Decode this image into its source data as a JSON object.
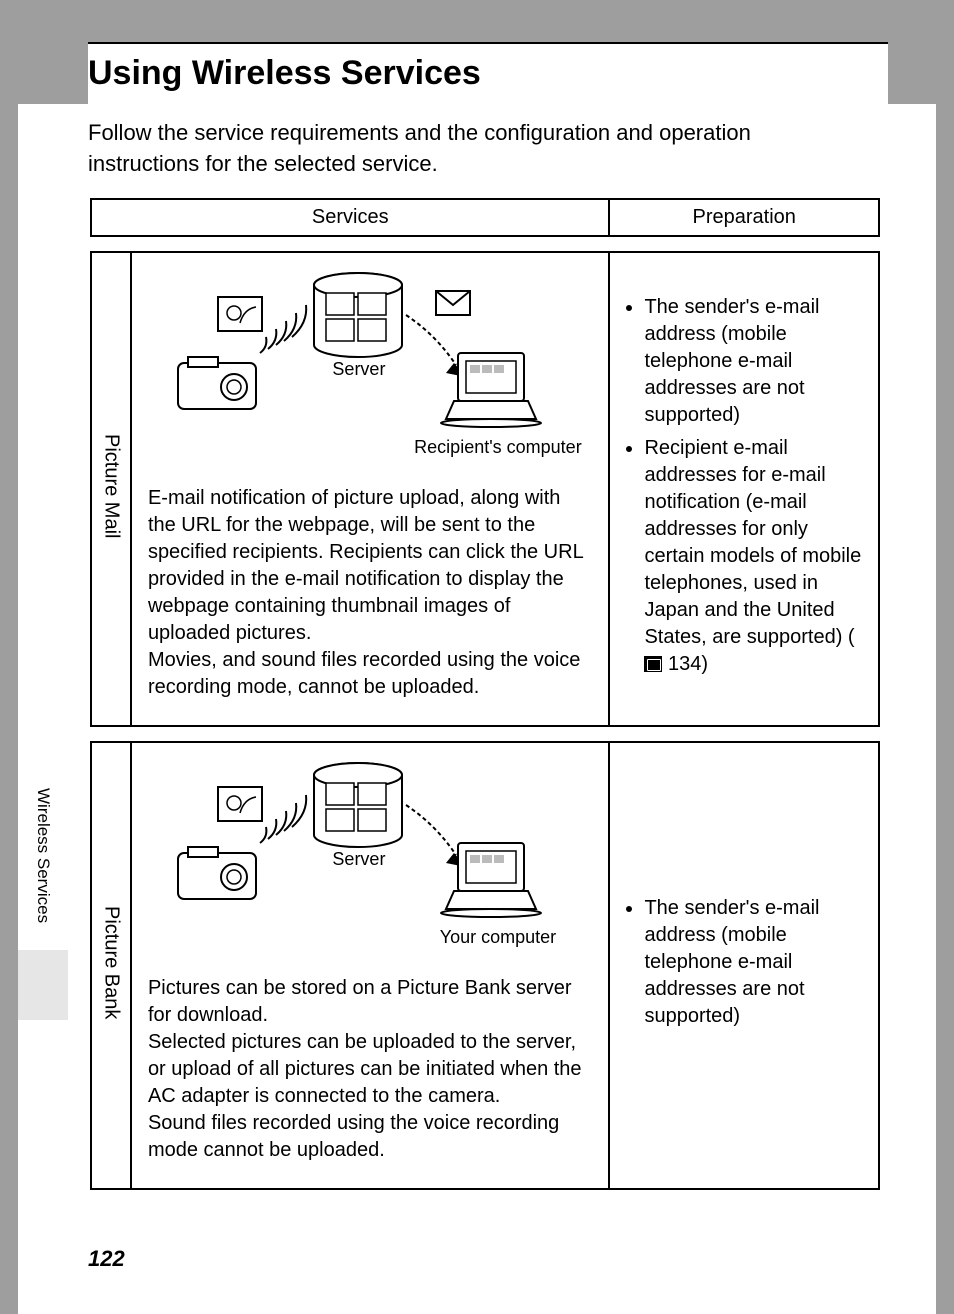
{
  "title": "Using Wireless Services",
  "intro": "Follow the service requirements and the configuration and operation instructions for the selected service.",
  "headers": {
    "services": "Services",
    "preparation": "Preparation"
  },
  "side_tab": "Wireless Services",
  "page_number": "122",
  "rows": [
    {
      "label": "Picture Mail",
      "diagram": {
        "server": "Server",
        "target": "Recipient's computer"
      },
      "description": "E-mail notification of picture upload, along with the URL for the webpage, will be sent to the specified recipients. Recipients can click the URL provided in the e-mail notification to display the webpage containing thumbnail images of uploaded pictures.\nMovies, and sound files recorded using the voice recording mode, cannot be uploaded.",
      "prep": [
        "The sender's e-mail address (mobile telephone e-mail addresses are not supported)",
        "Recipient e-mail addresses for e-mail notification (e-mail addresses for only certain models of mobile telephones, used in Japan and the United States, are supported) "
      ],
      "prep_ref": "134"
    },
    {
      "label": "Picture Bank",
      "diagram": {
        "server": "Server",
        "target": "Your computer"
      },
      "description": "Pictures can be stored on a Picture Bank server for download.\nSelected pictures can be uploaded to the server, or upload of all pictures can be initiated when the AC adapter is connected to the camera.\nSound files recorded using the voice recording mode cannot be uploaded.",
      "prep": [
        "The sender's e-mail address (mobile telephone e-mail addresses are not supported)"
      ],
      "prep_ref": null
    }
  ]
}
